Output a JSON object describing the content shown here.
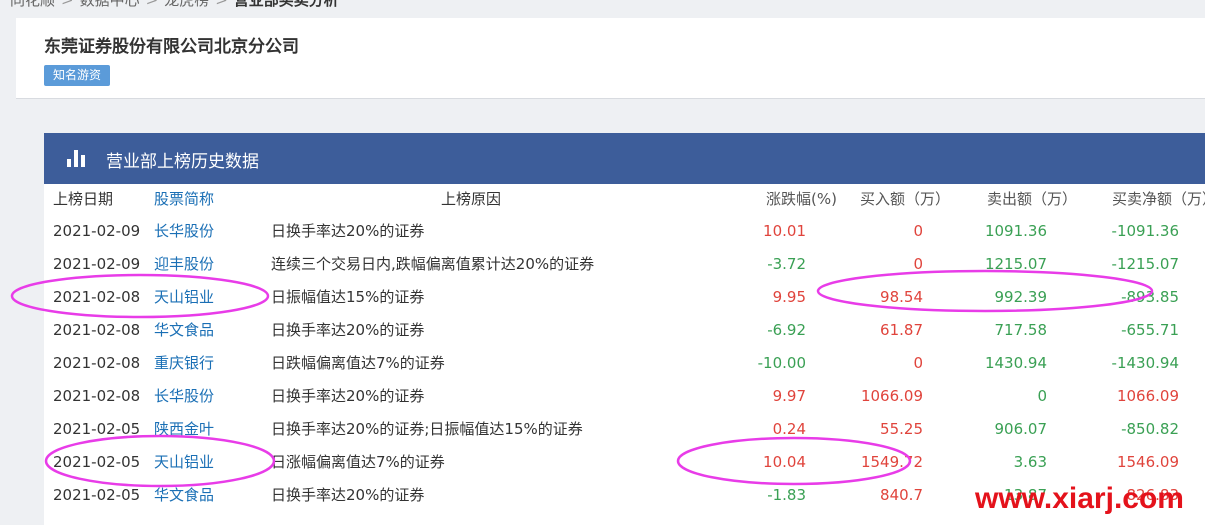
{
  "breadcrumb": {
    "items": [
      "同花顺",
      "数据中心",
      "龙虎榜",
      "营业部买卖分析"
    ]
  },
  "header": {
    "firm_name": "东莞证券股份有限公司北京分公司",
    "tag": "知名游资"
  },
  "panel": {
    "icon": "bar-chart-icon",
    "title": "营业部上榜历史数据"
  },
  "table": {
    "columns": [
      "上榜日期",
      "股票简称",
      "上榜原因",
      "涨跌幅(%)",
      "买入额（万）",
      "卖出额（万）",
      "买卖净额（万）"
    ],
    "rows": [
      {
        "date": "2021-02-09",
        "name": "长华股份",
        "reason": "日换手率达20%的证券",
        "change": "10.01",
        "buy": "0",
        "sell": "1091.36",
        "net": "-1091.36"
      },
      {
        "date": "2021-02-09",
        "name": "迎丰股份",
        "reason": "连续三个交易日内,跌幅偏离值累计达20%的证券",
        "change": "-3.72",
        "buy": "0",
        "sell": "1215.07",
        "net": "-1215.07"
      },
      {
        "date": "2021-02-08",
        "name": "天山铝业",
        "reason": "日振幅值达15%的证券",
        "change": "9.95",
        "buy": "98.54",
        "sell": "992.39",
        "net": "-893.85"
      },
      {
        "date": "2021-02-08",
        "name": "华文食品",
        "reason": "日换手率达20%的证券",
        "change": "-6.92",
        "buy": "61.87",
        "sell": "717.58",
        "net": "-655.71"
      },
      {
        "date": "2021-02-08",
        "name": "重庆银行",
        "reason": "日跌幅偏离值达7%的证券",
        "change": "-10.00",
        "buy": "0",
        "sell": "1430.94",
        "net": "-1430.94"
      },
      {
        "date": "2021-02-08",
        "name": "长华股份",
        "reason": "日换手率达20%的证券",
        "change": "9.97",
        "buy": "1066.09",
        "sell": "0",
        "net": "1066.09"
      },
      {
        "date": "2021-02-05",
        "name": "陕西金叶",
        "reason": "日换手率达20%的证券;日振幅值达15%的证券",
        "change": "0.24",
        "buy": "55.25",
        "sell": "906.07",
        "net": "-850.82"
      },
      {
        "date": "2021-02-05",
        "name": "天山铝业",
        "reason": "日涨幅偏离值达7%的证券",
        "change": "10.04",
        "buy": "1549.72",
        "sell": "3.63",
        "net": "1546.09"
      },
      {
        "date": "2021-02-05",
        "name": "华文食品",
        "reason": "日换手率达20%的证券",
        "change": "-1.83",
        "buy": "840.7",
        "sell": "13.87",
        "net": "826.83"
      }
    ]
  },
  "annotation_color": "#e83ce8",
  "colors": {
    "up": "#e0443c",
    "down": "#3aa054",
    "link": "#1a6fb5",
    "panel_header": "#3d5d9a",
    "tag": "#5b9bd9"
  },
  "watermark": "www.xiarj.com"
}
